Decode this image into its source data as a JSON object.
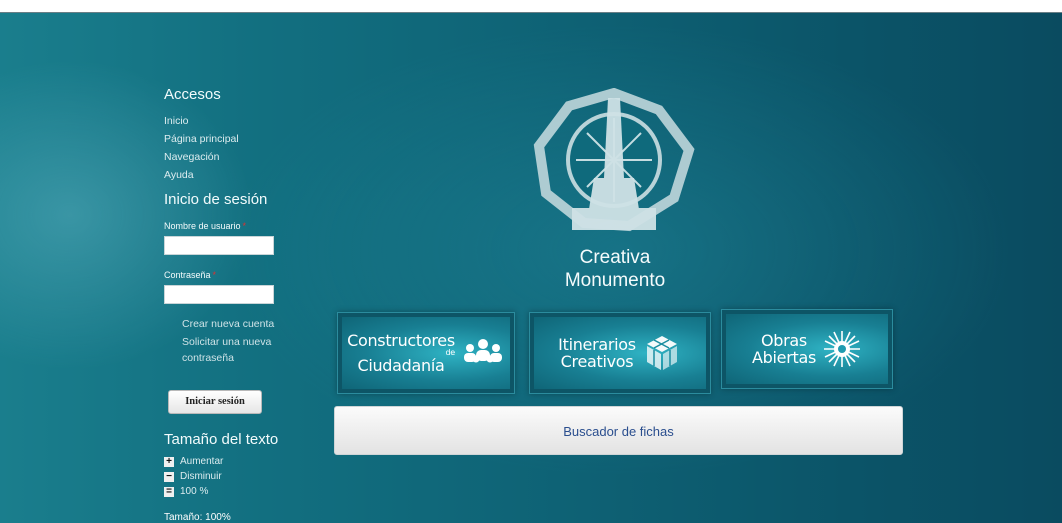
{
  "sidebar": {
    "accesos_title": "Accesos",
    "nav": [
      "Inicio",
      "Página principal",
      "Navegación",
      "Ayuda"
    ],
    "login": {
      "title": "Inicio de sesión",
      "username_label": "Nombre de usuario",
      "password_label": "Contraseña",
      "required_mark": "*",
      "username_value": "",
      "password_value": "",
      "create_account": "Crear nueva cuenta",
      "request_password": "Solicitar una nueva contraseña",
      "submit_label": "Iniciar sesión"
    },
    "text_size": {
      "title": "Tamaño del texto",
      "increase": "Aumentar",
      "decrease": "Disminuir",
      "reset": "100 %",
      "current": "Tamaño: 100%"
    }
  },
  "logo": {
    "line1": "Creativa",
    "line2": "Monumento"
  },
  "banners": [
    {
      "line1": "Constructores",
      "small": "de",
      "line2": "Ciudadanía",
      "icon": "people-group-icon"
    },
    {
      "line1": "Itinerarios",
      "line2": "Creativos",
      "icon": "cube-icon"
    },
    {
      "line1": "Obras",
      "line2": "Abiertas",
      "icon": "sunburst-icon"
    }
  ],
  "search": {
    "label": "Buscador de fichas"
  },
  "colors": {
    "background": "#0e6174",
    "required": "#e03030",
    "link_blue": "#2a4e8e"
  }
}
